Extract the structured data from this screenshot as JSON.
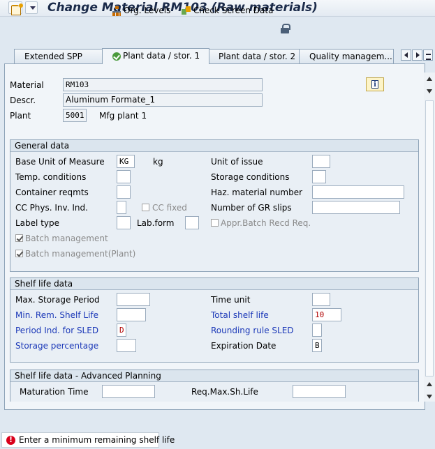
{
  "window": {
    "title": "Change Material RM103 (Raw materials)"
  },
  "toolbar": {
    "org_levels": "Org. Levels",
    "check_screen_data": "Check Screen Data"
  },
  "tabs": [
    {
      "label": "Extended SPP"
    },
    {
      "label": "Plant data / stor. 1",
      "active": true
    },
    {
      "label": "Plant data / stor. 2"
    },
    {
      "label": "Quality managem..."
    }
  ],
  "header": {
    "material_label": "Material",
    "material_value": "RM103",
    "descr_label": "Descr.",
    "descr_value": "Aluminum Formate_1",
    "plant_label": "Plant",
    "plant_value": "5001",
    "plant_name": "Mfg plant 1"
  },
  "general": {
    "title": "General data",
    "base_uom_label": "Base Unit of Measure",
    "base_uom_value": "KG",
    "base_uom_text": "kg",
    "unit_issue_label": "Unit of issue",
    "temp_label": "Temp. conditions",
    "storage_label": "Storage conditions",
    "container_label": "Container reqmts",
    "haz_label": "Haz. material number",
    "cc_phys_label": "CC Phys. Inv. Ind.",
    "cc_fixed_label": "CC fixed",
    "gr_slips_label": "Number of GR slips",
    "label_type_label": "Label type",
    "lab_form_label": "Lab.form",
    "appr_batch_label": "Appr.Batch Recd Req.",
    "batch_mgmt_label": "Batch management",
    "batch_mgmt_plant_label": "Batch management(Plant)"
  },
  "shelf": {
    "title": "Shelf life data",
    "max_storage_label": "Max. Storage Period",
    "time_unit_label": "Time unit",
    "min_rem_label": "Min. Rem. Shelf Life",
    "total_shelf_label": "Total shelf life",
    "total_shelf_value": "10",
    "period_ind_label": "Period Ind. for SLED",
    "period_ind_value": "D",
    "rounding_label": "Rounding rule SLED",
    "storage_pct_label": "Storage percentage",
    "expiration_label": "Expiration Date",
    "expiration_value": "B"
  },
  "advanced": {
    "title": "Shelf life data - Advanced Planning",
    "maturation_label": "Maturation Time",
    "req_max_label": "Req.Max.Sh.Life"
  },
  "status": {
    "message": "Enter a minimum remaining shelf life"
  },
  "colors": {
    "label_required": "#1c39b8",
    "value_red": "#b00000",
    "error": "#d9001b"
  }
}
